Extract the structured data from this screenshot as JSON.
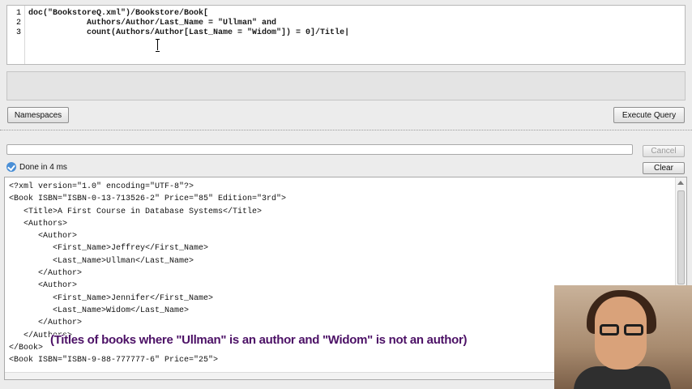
{
  "editor": {
    "line_numbers": [
      "1",
      "2",
      "3"
    ],
    "lines": [
      "doc(\"BookstoreQ.xml\")/Bookstore/Book[",
      "            Authors/Author/Last_Name = \"Ullman\" and",
      "            count(Authors/Author[Last_Name = \"Widom\"]) = 0]/Title|"
    ]
  },
  "buttons": {
    "namespaces": "Namespaces",
    "execute": "Execute Query",
    "cancel": "Cancel",
    "clear": "Clear"
  },
  "status": {
    "text": "Done in 4 ms",
    "icon": "check-icon"
  },
  "results": {
    "lines": [
      "<?xml version=\"1.0\" encoding=\"UTF-8\"?>",
      "<Book ISBN=\"ISBN-0-13-713526-2\" Price=\"85\" Edition=\"3rd\">",
      "   <Title>A First Course in Database Systems</Title>",
      "   <Authors>",
      "      <Author>",
      "         <First_Name>Jeffrey</First_Name>",
      "         <Last_Name>Ullman</Last_Name>",
      "      </Author>",
      "      <Author>",
      "         <First_Name>Jennifer</First_Name>",
      "         <Last_Name>Widom</Last_Name>",
      "      </Author>",
      "   </Authors>",
      "</Book>",
      "<Book ISBN=\"ISBN-9-88-777777-6\" Price=\"25\">"
    ]
  },
  "caption": "(Titles of books where \"Ullman\" is an author and \"Widom\" is not an author)",
  "colors": {
    "caption": "#4c1166",
    "status_icon": "#4a8fd6"
  }
}
